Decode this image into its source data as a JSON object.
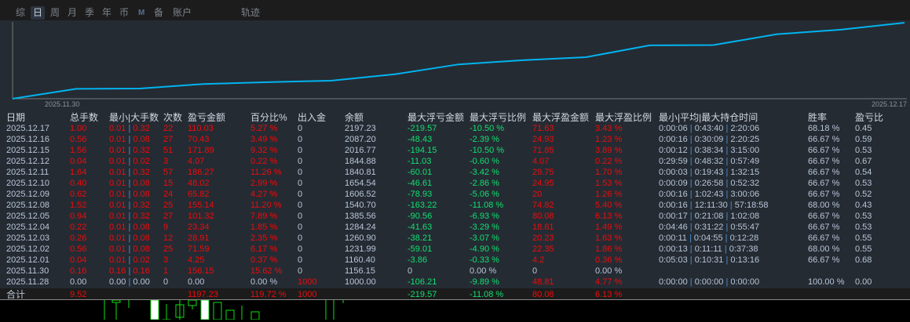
{
  "tabs": [
    "综",
    "日",
    "周",
    "月",
    "季",
    "年",
    "币",
    "M",
    "备",
    "账户",
    "轨迹"
  ],
  "active_tab": "日",
  "chart": {
    "x_start_label": "2025.11.30",
    "x_end_label": "2025.12.17",
    "line_color": "#00b4f0"
  },
  "columns": [
    "日期",
    "总手数",
    "最小|大手数",
    "次数",
    "盈亏金额",
    "百分比%",
    "出入金",
    "余额",
    "最大浮亏金额",
    "最大浮亏比例",
    "最大浮盈金额",
    "最大浮盈比例",
    "最小|平均|最大持仓时间",
    "胜率",
    "盈亏比"
  ],
  "rows": [
    [
      "2025.12.17",
      "1.00",
      "0.01|0.32",
      "22",
      "110.03",
      "5.27 %",
      "0",
      "2197.23",
      "-219.57",
      "-10.50 %",
      "71.63",
      "3.43 %",
      "0:00:06|0:43:40|2:20:06",
      "68.18 %",
      "0.45"
    ],
    [
      "2025.12.16",
      "0.56",
      "0.01|0.08",
      "27",
      "70.43",
      "3.49 %",
      "0",
      "2087.20",
      "-48.43",
      "-2.39 %",
      "24.93",
      "1.23 %",
      "0:00:16|0:30:09|2:20:25",
      "66.67 %",
      "0.59"
    ],
    [
      "2025.12.15",
      "1.56",
      "0.01|0.32",
      "51",
      "171.89",
      "9.32 %",
      "0",
      "2016.77",
      "-194.15",
      "-10.50 %",
      "71.85",
      "3.89 %",
      "0:00:12|0:38:34|3:15:00",
      "66.67 %",
      "0.53"
    ],
    [
      "2025.12.12",
      "0.04",
      "0.01|0.02",
      "3",
      "4.07",
      "0.22 %",
      "0",
      "1844.88",
      "-11.03",
      "-0.60 %",
      "4.07",
      "0.22 %",
      "0:29:59|0:48:32|0:57:49",
      "66.67 %",
      "0.67"
    ],
    [
      "2025.12.11",
      "1.64",
      "0.01|0.32",
      "57",
      "186.27",
      "11.26 %",
      "0",
      "1840.81",
      "-60.01",
      "-3.42 %",
      "29.75",
      "1.70 %",
      "0:00:03|0:19:43|1:32:15",
      "66.67 %",
      "0.54"
    ],
    [
      "2025.12.10",
      "0.40",
      "0.01|0.08",
      "15",
      "48.02",
      "2.99 %",
      "0",
      "1654.54",
      "-46.61",
      "-2.86 %",
      "24.95",
      "1.53 %",
      "0:00:09|0:26:58|0:52:32",
      "66.67 %",
      "0.53"
    ],
    [
      "2025.12.09",
      "0.62",
      "0.01|0.08",
      "24",
      "65.82",
      "4.27 %",
      "0",
      "1606.52",
      "-78.93",
      "-5.06 %",
      "20",
      "1.26 %",
      "0:00:16|1:02:43|3:00:06",
      "66.67 %",
      "0.52"
    ],
    [
      "2025.12.08",
      "1.52",
      "0.01|0.32",
      "25",
      "155.14",
      "11.20 %",
      "0",
      "1540.70",
      "-163.22",
      "-11.08 %",
      "74.82",
      "5.40 %",
      "0:00:16|12:11:30|57:18:58",
      "68.00 %",
      "0.43"
    ],
    [
      "2025.12.05",
      "0.94",
      "0.01|0.32",
      "27",
      "101.32",
      "7.89 %",
      "0",
      "1385.56",
      "-90.56",
      "-6.93 %",
      "80.08",
      "6.13 %",
      "0:00:17|0:21:08|1:02:08",
      "66.67 %",
      "0.53"
    ],
    [
      "2025.12.04",
      "0.22",
      "0.01|0.08",
      "9",
      "23.34",
      "1.85 %",
      "0",
      "1284.24",
      "-41.63",
      "-3.29 %",
      "18.81",
      "1.49 %",
      "0:04:46|0:31:22|0:55:47",
      "66.67 %",
      "0.53"
    ],
    [
      "2025.12.03",
      "0.26",
      "0.01|0.08",
      "12",
      "28.91",
      "2.35 %",
      "0",
      "1260.90",
      "-38.21",
      "-3.07 %",
      "20.23",
      "1.63 %",
      "0:00:11|0:04:55|0:12:28",
      "66.67 %",
      "0.55"
    ],
    [
      "2025.12.02",
      "0.56",
      "0.01|0.08",
      "25",
      "71.59",
      "6.17 %",
      "0",
      "1231.99",
      "-59.01",
      "-4.90 %",
      "22.35",
      "1.86 %",
      "0:00:13|0:11:11|0:37:38",
      "68.00 %",
      "0.55"
    ],
    [
      "2025.12.01",
      "0.04",
      "0.01|0.02",
      "3",
      "4.25",
      "0.37 %",
      "0",
      "1160.40",
      "-3.86",
      "-0.33 %",
      "4.2",
      "0.36 %",
      "0:05:03|0:10:31|0:13:16",
      "66.67 %",
      "0.68"
    ],
    [
      "2025.11.30",
      "0.16",
      "0.16|0.16",
      "1",
      "156.15",
      "15.62 %",
      "0",
      "1156.15",
      "0",
      "0.00 %",
      "0",
      "0.00 %",
      "",
      "",
      ""
    ],
    [
      "2025.11.28",
      "0.00",
      "0.00|0.00",
      "0",
      "0.00",
      "0.00 %",
      "1000",
      "1000.00",
      "-106.21",
      "-9.89 %",
      "48.81",
      "4.77 %",
      "0:00:00|0:00:00|0:00:00",
      "100.00 %",
      "0.00"
    ]
  ],
  "total": [
    "合计",
    "9.52",
    "",
    "",
    "1197.23",
    "119.72 %",
    "1000",
    "",
    "-219.57",
    "-11.08 %",
    "80.08",
    "6.13 %",
    "",
    "",
    ""
  ],
  "colors": {
    "profit": "#f00a0a",
    "loss": "#10e070",
    "neutral": "#b8c6d8"
  }
}
